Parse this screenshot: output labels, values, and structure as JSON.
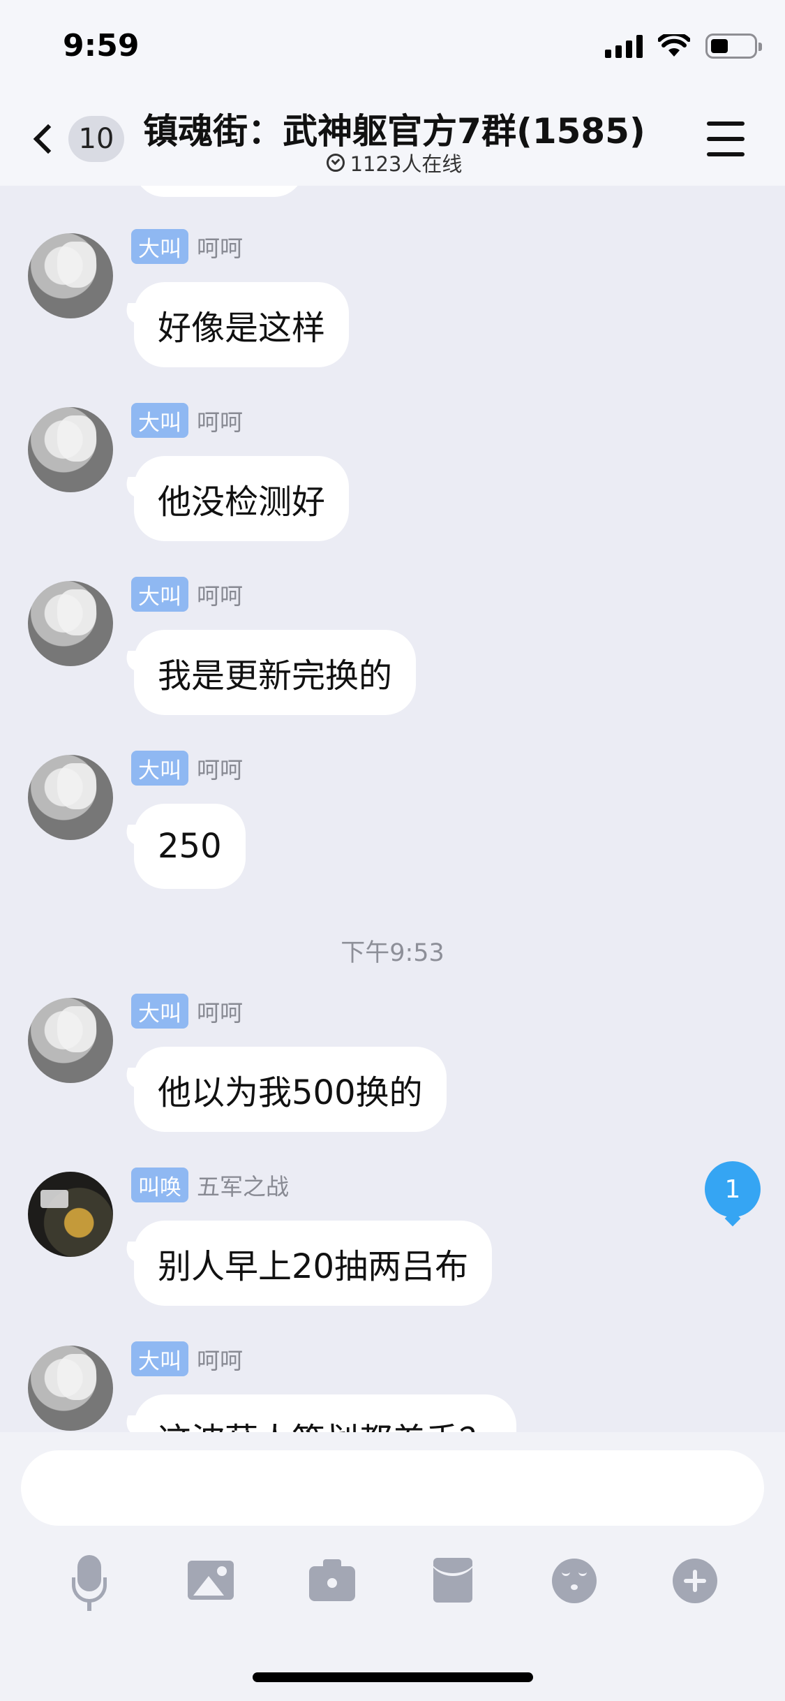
{
  "status_bar": {
    "time": "9:59"
  },
  "header": {
    "unread_count": "10",
    "title": "镇魂街：武神躯官方7群(1585)",
    "online_text": "1123人在线"
  },
  "messages": [
    {
      "tag": "大叫",
      "sender": "呵呵",
      "text": "好像是这样",
      "avatar": "anime-boy-gray"
    },
    {
      "tag": "大叫",
      "sender": "呵呵",
      "text": "他没检测好",
      "avatar": "anime-boy-gray"
    },
    {
      "tag": "大叫",
      "sender": "呵呵",
      "text": "我是更新完换的",
      "avatar": "anime-boy-gray"
    },
    {
      "tag": "大叫",
      "sender": "呵呵",
      "text": "250",
      "avatar": "anime-boy-gray"
    },
    {
      "tag": "大叫",
      "sender": "呵呵",
      "text": "他以为我500换的",
      "avatar": "anime-boy-gray"
    },
    {
      "tag": "叫唤",
      "sender": "五军之战",
      "text": "别人早上20抽两吕布",
      "avatar": "game-ssr-card"
    },
    {
      "tag": "大叫",
      "sender": "呵呵",
      "text": "这波薛人策划都差手？",
      "avatar": "anime-boy-gray"
    }
  ],
  "timestamp": "下午9:53",
  "new_message_badge": "1",
  "input": {
    "placeholder": ""
  },
  "toolbar": [
    "microphone-icon",
    "image-icon",
    "camera-icon",
    "red-packet-icon",
    "emoji-icon",
    "plus-icon"
  ],
  "colors": {
    "background": "#ebecf4",
    "tag": "#8fb8f2",
    "badge": "#35a5f3",
    "toolbar_icon": "#a3a7b4"
  }
}
